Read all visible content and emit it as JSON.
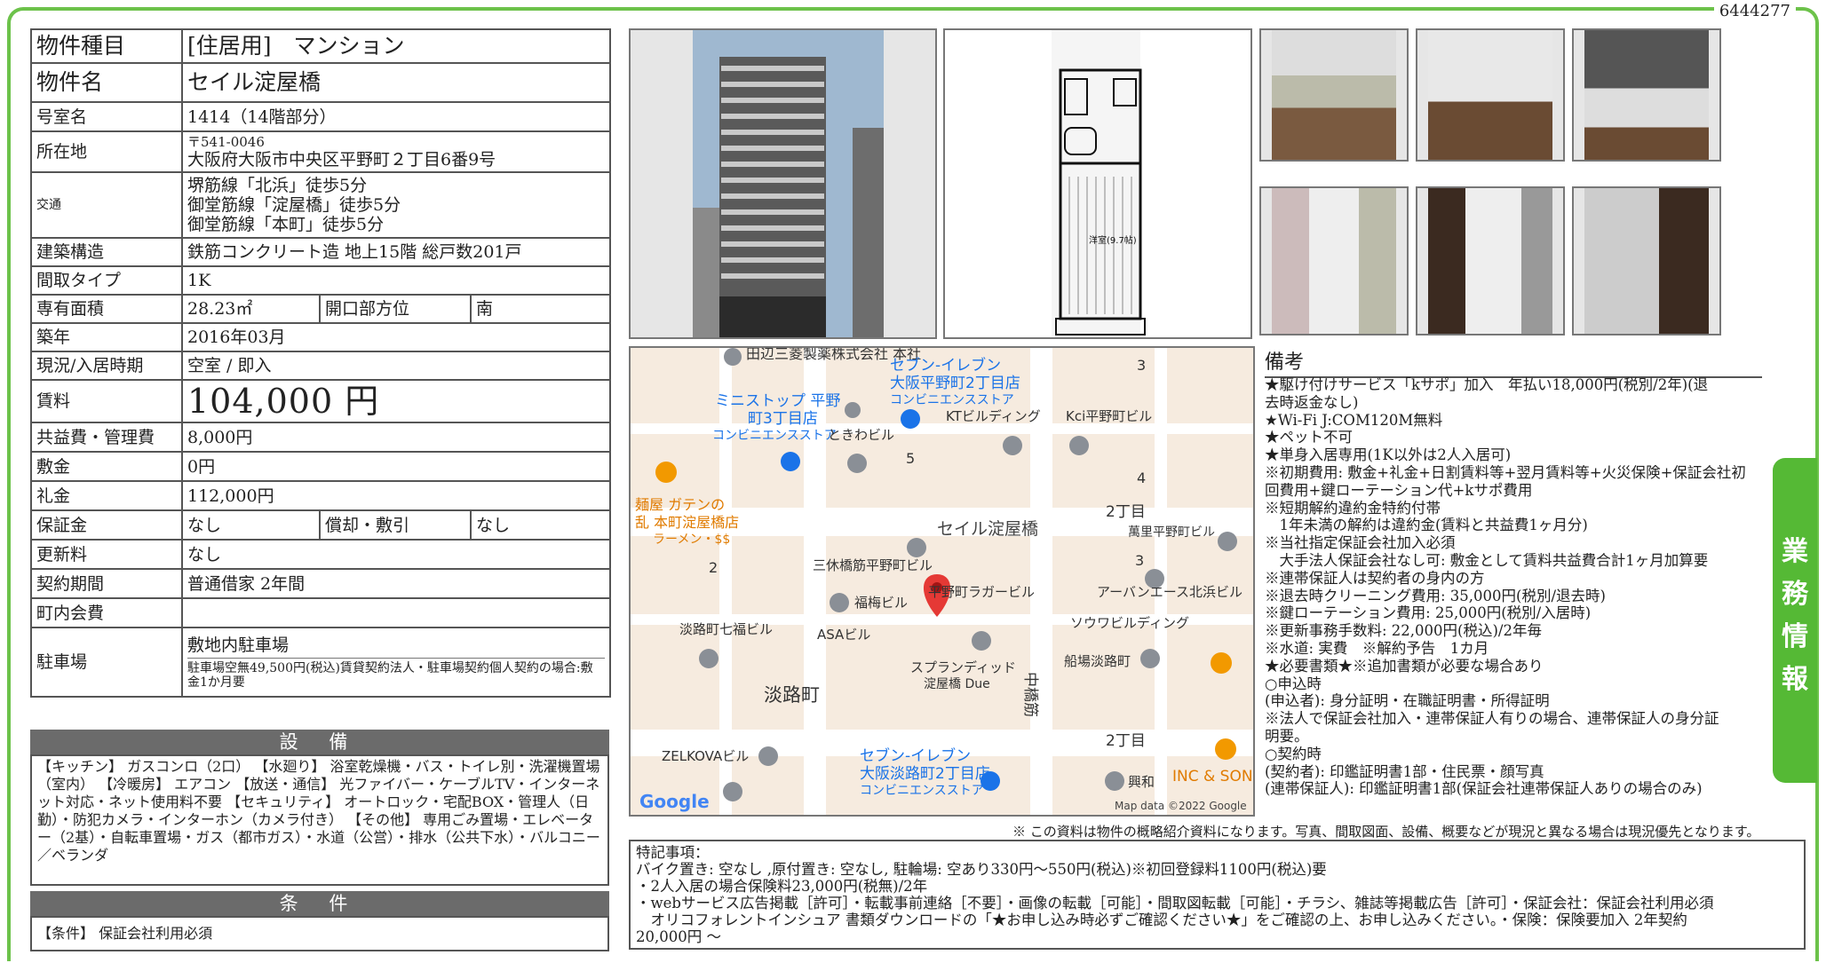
{
  "doc_id": "6444277",
  "spec": {
    "type_label": "物件種目",
    "type_value": "[住居用]　マンション",
    "name_label": "物件名",
    "name_value": "セイル淀屋橋",
    "room_label": "号室名",
    "room_value": "1414（14階部分）",
    "address_label": "所在地",
    "postal": "〒541-0046",
    "address_value": "大阪府大阪市中央区平野町２丁目6番9号",
    "transport_label": "交通",
    "transport": [
      "堺筋線「北浜」徒歩5分",
      "御堂筋線「淀屋橋」徒歩5分",
      "御堂筋線「本町」徒歩5分"
    ],
    "structure_label": "建築構造",
    "structure_value": "鉄筋コンクリート造 地上15階 総戸数201戸",
    "layout_label": "間取タイプ",
    "layout_value": "1K",
    "area_label": "専有面積",
    "area_value": "28.23㎡",
    "direction_label": "開口部方位",
    "direction_value": "南",
    "built_label": "築年",
    "built_value": "2016年03月",
    "status_label": "現況/入居時期",
    "status_value": "空室 / 即入",
    "rent_label": "賃料",
    "rent_value": "104,000 円",
    "fee_label": "共益費・管理費",
    "fee_value": "8,000円",
    "deposit_label": "敷金",
    "deposit_value": "0円",
    "keymoney_label": "礼金",
    "keymoney_value": "112,000円",
    "guarantee_label": "保証金",
    "guarantee_value": "なし",
    "amort_label": "償却・敷引",
    "amort_value": "なし",
    "renewal_label": "更新料",
    "renewal_value": "なし",
    "contract_label": "契約期間",
    "contract_value": "普通借家 2年間",
    "town_label": "町内会費",
    "town_value": "",
    "parking_label": "駐車場",
    "parking_value": "敷地内駐車場",
    "parking_note": "駐車場空無49,500円(税込)賃貸契約法人・駐車場契約個人契約の場合:敷金1か月要"
  },
  "facilities": {
    "title": "設 備",
    "text": "【キッチン】 ガスコンロ（2口） 【水廻り】 浴室乾燥機・バス・トイレ別・洗濯機置場（室内） 【冷暖房】 エアコン 【放送・通信】 光ファイバー・ケーブルTV・インターネット対応・ネット使用料不要 【セキュリティ】 オートロック・宅配BOX・管理人（日勤）・防犯カメラ・インターホン（カメラ付き） 【その他】 専用ごみ置場・エレベーター（2基）・自転車置場・ガス（都市ガス）・水道（公営）・排水（公共下水）・バルコニー／ベランダ"
  },
  "conditions": {
    "title": "条 件",
    "text": "【条件】 保証会社利用必須"
  },
  "floorplan_label": "洋室(9.7帖)",
  "map": {
    "labels": [
      "田辺三菱製薬株式会社 本社",
      "セブン-イレブン",
      "大阪平野町2丁目店",
      "コンビニエンスストア",
      "ミニストップ 平野",
      "町3丁目店",
      "コンビニエンスストア",
      "KTビルディング",
      "Kci平野町ビル",
      "ときわビル",
      "麺屋 ガテンの",
      "乱 本町淀屋橋店",
      "ラーメン・$$",
      "セイル淀屋橋",
      "2丁目",
      "萬里平野町ビル",
      "三休橋筋平野町ビル",
      "平野町ラガービル",
      "アーバンエース北浜ビル",
      "福梅ビル",
      "ソウワビルディング",
      "淡路町七福ビル",
      "ASAビル",
      "スプランディッド",
      "淀屋橋 Due",
      "船場淡路町",
      "淡路町",
      "中橋筋",
      "2丁目",
      "ZELKOVAビル",
      "セブン-イレブン",
      "大阪淡路町2丁目店",
      "コンビニエンスストア",
      "興和",
      "INC & SONS",
      "Google",
      "Map data ©2022 Google",
      "3",
      "4",
      "5",
      "2",
      "3"
    ]
  },
  "notes_title": "備考",
  "notes": [
    "★駆け付けサービス「kサポ」加入　年払い18,000円(税別/2年)(退",
    "去時返金なし)",
    "★Wi-Fi J:COM120M無料",
    "★ペット不可",
    "★単身入居専用(1K以外は2人入居可)",
    "※初期費用: 敷金+礼金+日割賃料等+翌月賃料等+火災保険+保証会社初",
    "回費用+鍵ローテーション代+kサポ費用",
    "※短期解約違約金特約付帯",
    "　1年未満の解約は違約金(賃料と共益費1ヶ月分)",
    "※当社指定保証会社加入必須",
    "　大手法人保証会社なし可: 敷金として賃料共益費合計1ヶ月加算要",
    "※連帯保証人は契約者の身内の方",
    "※退去時クリーニング費用: 35,000円(税別/退去時)",
    "※鍵ローテーション費用: 25,000円(税別/入居時)",
    "※更新事務手数料: 22,000円(税込)/2年毎",
    "※水道: 実費　※解約予告　1カ月",
    "★必要書類★※追加書類が必要な場合あり",
    "○申込時",
    "(申込者): 身分証明・在職証明書・所得証明",
    "※法人で保証会社加入・連帯保証人有りの場合、連帯保証人の身分証",
    "明要。",
    "○契約時",
    "(契約者): 印鑑証明書1部・住民票・顔写真",
    "(連帯保証人): 印鑑証明書1部(保証会社連帯保証人ありの場合のみ)"
  ],
  "disclaimer": "※ この資料は物件の概略紹介資料になります。写真、間取図面、設備、概要などが現況と異なる場合は現況優先となります。",
  "special": [
    "特記事項：",
    "バイク置き: 空なし ,原付置き: 空なし, 駐輪場: 空あり330円〜550円(税込)※初回登録料1100円(税込)要",
    "・2人入居の場合保険料23,000円(税無)/2年",
    "・webサービス広告掲載［許可］・転載事前連絡［不要］・画像の転載［可能］・間取図転載［可能］・チラシ、雑誌等掲載広告［許可］・保証会社：保証会社利用必須",
    "　オリコフォレントインシュア 書類ダウンロードの「★お申し込み時必ずご確認ください★」をご確認の上、お申し込みください。・保険：保険要加入 2年契約",
    "20,000円 〜"
  ],
  "side_tab": "業務情報"
}
